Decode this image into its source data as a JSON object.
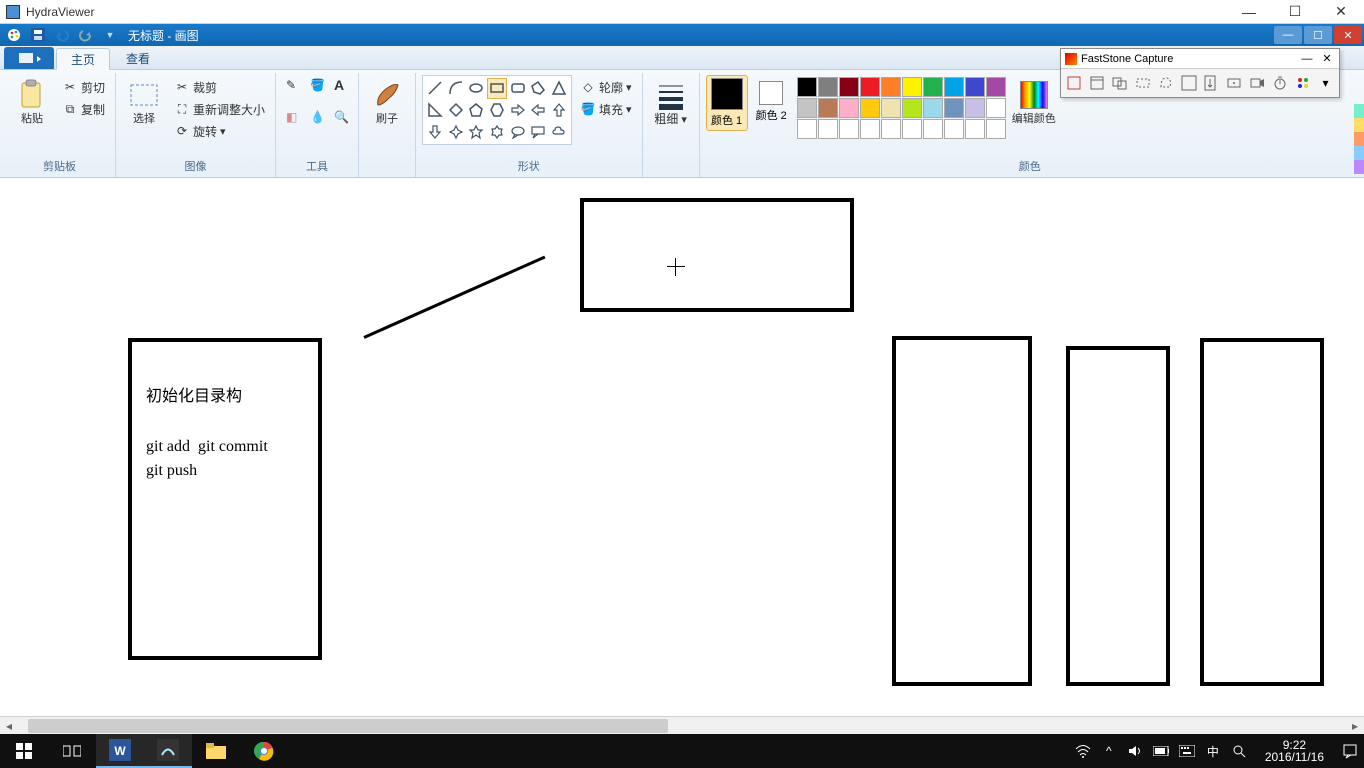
{
  "outer_window": {
    "title": "HydraViewer"
  },
  "paint_window": {
    "doc_title": "无标题 - 画图",
    "tabs": {
      "file": "",
      "home": "主页",
      "view": "查看"
    }
  },
  "ribbon": {
    "clipboard": {
      "label": "剪贴板",
      "paste": "粘贴",
      "cut": "剪切",
      "copy": "复制"
    },
    "image": {
      "label": "图像",
      "select": "选择",
      "crop": "裁剪",
      "resize": "重新调整大小",
      "rotate": "旋转"
    },
    "tools": {
      "label": "工具"
    },
    "brush": {
      "label": "刷子"
    },
    "shapes": {
      "label": "形状",
      "outline": "轮廓",
      "fill": "填充"
    },
    "thickness": {
      "label": "粗细"
    },
    "colors": {
      "label": "颜色",
      "c1": "颜色 1",
      "c2": "颜色 2",
      "edit": "编辑颜色"
    }
  },
  "palette_colors": [
    "#000000",
    "#7f7f7f",
    "#880015",
    "#ed1c24",
    "#ff7f27",
    "#fff200",
    "#22b14c",
    "#00a2e8",
    "#3f48cc",
    "#a349a4",
    "#c3c3c3",
    "#b97a57",
    "#ffaec9",
    "#ffc90e",
    "#efe4b0",
    "#b5e61d",
    "#99d9ea",
    "#7092be",
    "#c8bfe7",
    "#ffffff",
    "#ffffff",
    "#ffffff",
    "#ffffff",
    "#ffffff",
    "#ffffff",
    "#ffffff",
    "#ffffff",
    "#ffffff",
    "#ffffff",
    "#ffffff"
  ],
  "canvas": {
    "texts": {
      "line1": "初始化目录构",
      "line2": "git add  git commit",
      "line3": "git push"
    }
  },
  "fs": {
    "title": "FastStone Capture"
  },
  "taskbar": {
    "time": "9:22",
    "date": "2016/11/16",
    "ime": "中"
  }
}
